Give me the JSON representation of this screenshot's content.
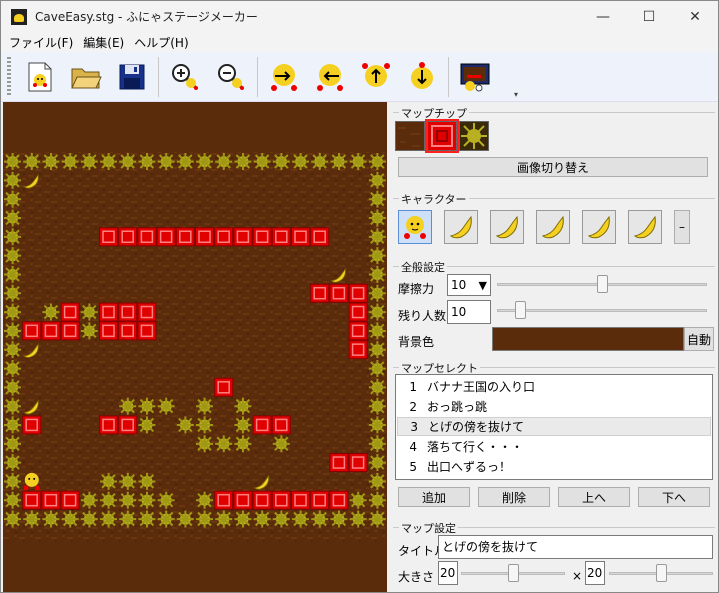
{
  "window": {
    "title": "CaveEasy.stg - ふにゃステージメーカー",
    "minimize_glyph": "—",
    "maximize_glyph": "☐",
    "close_glyph": "✕"
  },
  "menu": [
    {
      "label": "ファイル(F)"
    },
    {
      "label": "編集(E)"
    },
    {
      "label": "ヘルプ(H)"
    }
  ],
  "toolbar": {
    "buttons": [
      {
        "icon": "new-stage-icon"
      },
      {
        "icon": "open-folder-icon"
      },
      {
        "icon": "save-floppy-icon"
      },
      {
        "icon": "zoom-in-icon"
      },
      {
        "icon": "zoom-out-icon"
      },
      {
        "icon": "shift-right-icon"
      },
      {
        "icon": "shift-left-icon"
      },
      {
        "icon": "shift-up-icon"
      },
      {
        "icon": "shift-down-icon"
      },
      {
        "icon": "test-play-icon"
      }
    ],
    "overflow_glyph": "▾"
  },
  "map_chip": {
    "label": "マップチップ",
    "chips": [
      {
        "name": "dirt-wall",
        "color": "#5a2c0c"
      },
      {
        "name": "red-block",
        "color": "#e00000",
        "selected": true
      },
      {
        "name": "spike",
        "color": "#a8a010"
      }
    ],
    "switch_button": "画像切り替え"
  },
  "character": {
    "label": "キャラクター",
    "items": [
      {
        "icon": "funya-icon",
        "selected": true
      },
      {
        "icon": "banana-icon"
      },
      {
        "icon": "banana-icon"
      },
      {
        "icon": "banana-icon"
      },
      {
        "icon": "banana-icon"
      },
      {
        "icon": "banana-icon"
      }
    ],
    "remove_button": "–"
  },
  "general": {
    "label": "全般設定",
    "friction_label": "摩擦力",
    "friction_value": "10",
    "friction_dropdown_glyph": "▼",
    "friction_level": 0.5,
    "lives_label": "残り人数",
    "lives_value": "10",
    "lives_level": 0.09,
    "bgcolor_label": "背景色",
    "bgcolor_value": "#5a2c0c",
    "auto_button": "自動"
  },
  "map_select": {
    "label": "マップセレクト",
    "items": [
      {
        "num": "1",
        "title": "バナナ王国の入り口"
      },
      {
        "num": "2",
        "title": "おっ跳っ跳"
      },
      {
        "num": "3",
        "title": "とげの傍を抜けて",
        "selected": true
      },
      {
        "num": "4",
        "title": "落ちて行く・・・"
      },
      {
        "num": "5",
        "title": "出口へずるっ！"
      }
    ],
    "buttons": {
      "add": "追加",
      "delete": "削除",
      "up": "上へ",
      "down": "下へ"
    }
  },
  "map_settings": {
    "label": "マップ設定",
    "title_label": "タイトル",
    "title_value": "とげの傍を抜けて",
    "size_label": "大きさ",
    "width_value": "20",
    "width_level": 0.5,
    "times_glyph": "×",
    "height_value": "20",
    "height_level": 0.5
  },
  "stage": {
    "rows": [
      "####################",
      "#B.................#",
      "#..................#",
      "#..................#",
      "#....RRRRRRRRRRRR..#",
      "#..................#",
      "#................B.#",
      "#...............RRR#",
      "#.#R#RRR..........R#",
      "#RRR#RRR..........R#",
      "#B................R#",
      "#..................#",
      "#..........R.......#",
      "#B....###.#.#......#",
      "#R...RR#.##.#RR....#",
      "#.........###.#....#",
      "#................RR#",
      "#P...###.....B.....#",
      "#RRR#####.#RRRRRRR##",
      "####################"
    ]
  }
}
